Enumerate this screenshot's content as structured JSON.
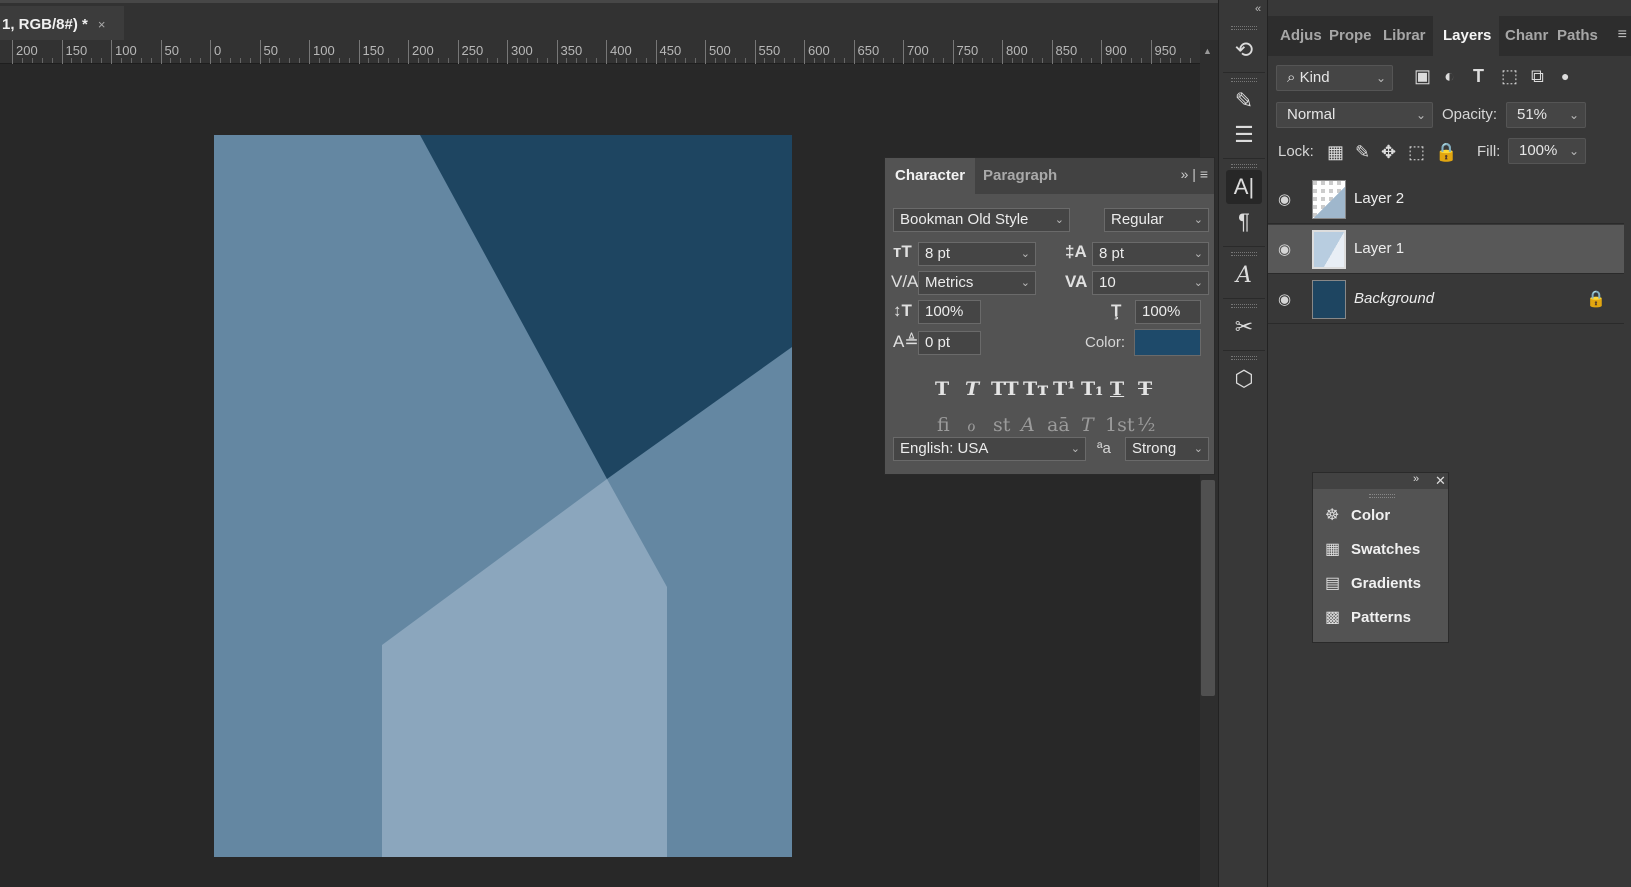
{
  "document": {
    "tab_title": "1, RGB/8#) *",
    "close": "×"
  },
  "ruler": {
    "labels": [
      "200",
      "150",
      "100",
      "50",
      "0",
      "50",
      "100",
      "150",
      "200",
      "250",
      "300",
      "350",
      "400",
      "450",
      "500",
      "550",
      "600",
      "650",
      "700",
      "750",
      "800",
      "850",
      "900",
      "950"
    ]
  },
  "right_panel": {
    "tabs": [
      "Adjus",
      "Prope",
      "Librar",
      "Layers",
      "Chanr",
      "Paths"
    ],
    "active_tab": "Layers",
    "menu_icon": "≡",
    "filter_kind": "Kind",
    "blend_mode": "Normal",
    "opacity_label": "Opacity:",
    "opacity_value": "51%",
    "lock_label": "Lock:",
    "fill_label": "Fill:",
    "fill_value": "100%",
    "layers": [
      {
        "name": "Layer 2",
        "visible": true,
        "selected": false,
        "locked": false
      },
      {
        "name": "Layer 1",
        "visible": true,
        "selected": true,
        "locked": false
      },
      {
        "name": "Background",
        "visible": true,
        "selected": false,
        "locked": true
      }
    ]
  },
  "character_panel": {
    "tabs": [
      "Character",
      "Paragraph"
    ],
    "active_tab": "Character",
    "font_family": "Bookman Old Style",
    "font_style": "Regular",
    "font_size": "8 pt",
    "leading": "8 pt",
    "kerning": "Metrics",
    "tracking": "10",
    "vertical_scale": "100%",
    "horizontal_scale": "100%",
    "baseline_shift": "0 pt",
    "color_label": "Color:",
    "color_value": "#1e4a6a",
    "type_styles": [
      "T",
      "T",
      "TT",
      "Tт",
      "T¹",
      "T₁",
      "T",
      "T"
    ],
    "opentype": [
      "ﬁ",
      "ℴ",
      "st",
      "A",
      "aā",
      "T",
      "1st",
      "½"
    ],
    "language": "English: USA",
    "antialias_icon": "ªa",
    "antialias": "Strong"
  },
  "mini_panel": {
    "items": [
      {
        "label": "Color",
        "icon": "palette-icon"
      },
      {
        "label": "Swatches",
        "icon": "swatches-icon"
      },
      {
        "label": "Gradients",
        "icon": "gradients-icon"
      },
      {
        "label": "Patterns",
        "icon": "patterns-icon"
      }
    ]
  },
  "colors": {
    "artboard_light": "#6487a2",
    "artboard_dark": "#1e4561",
    "artboard_pale": "#8ba6bd"
  }
}
